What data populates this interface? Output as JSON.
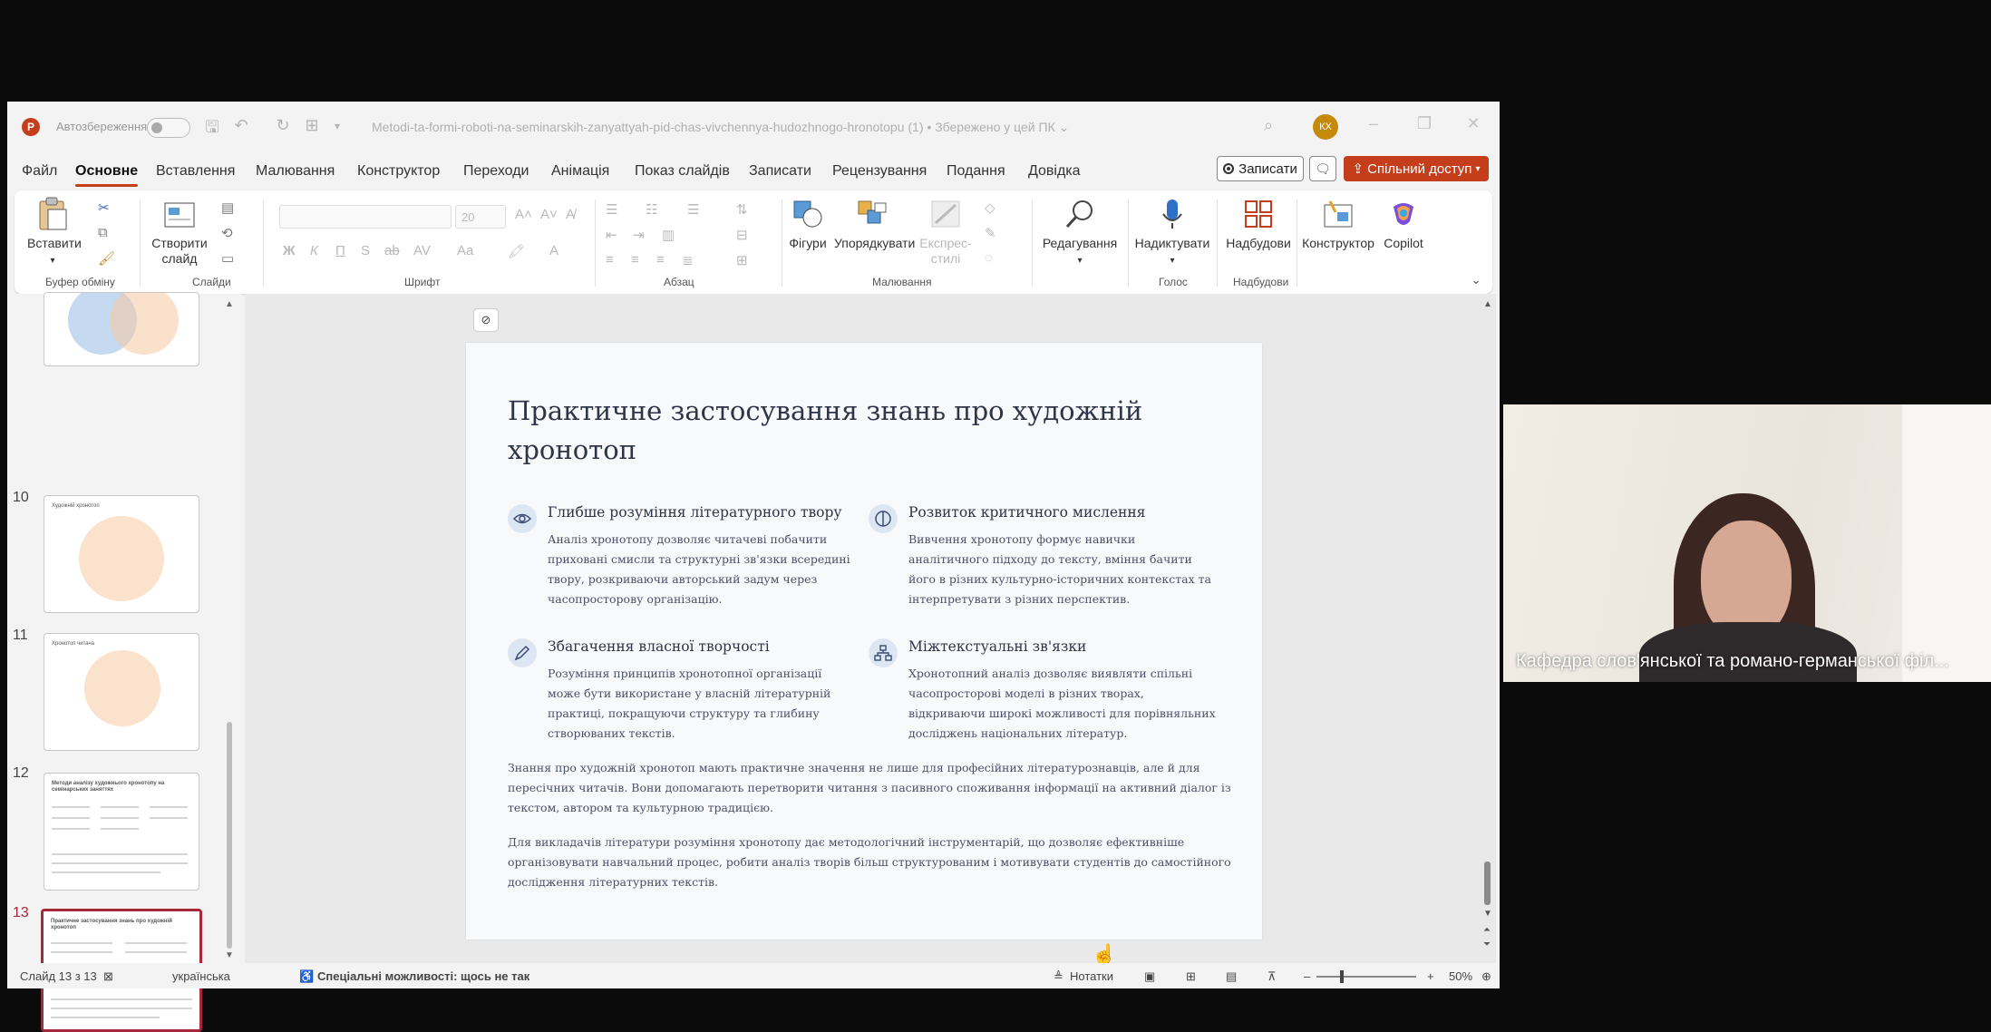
{
  "titlebar": {
    "autosave_label": "Автозбереження",
    "doc_title": "Metodi-ta-formi-roboti-na-seminarskih-zanyattyah-pid-chas-vivchennya-hudozhnogo-hronotopu (1) • Збережено у цей ПК ⌄",
    "avatar_initials": "КХ"
  },
  "tabs": [
    "Файл",
    "Основне",
    "Вставлення",
    "Малювання",
    "Конструктор",
    "Переходи",
    "Анімація",
    "Показ слайдів",
    "Записати",
    "Рецензування",
    "Подання",
    "Довідка"
  ],
  "actions": {
    "record_label": "Записати",
    "share_label": "Спільний доступ"
  },
  "ribbon": {
    "paste_label": "Вставити",
    "new_slide_label": "Створити слайд",
    "font_size": "20",
    "shapes_label": "Фігури",
    "arrange_label": "Упорядкувати",
    "quick_styles_label": "Експрес-стилі",
    "editing_label": "Редагування",
    "dictate_label": "Надиктувати",
    "addins_label": "Надбудови",
    "designer_label": "Конструктор",
    "copilot_label": "Copilot",
    "groups": {
      "clipboard": "Буфер обміну",
      "slides": "Слайди",
      "font": "Шрифт",
      "paragraph": "Абзац",
      "drawing": "Малювання",
      "voice": "Голос",
      "addins": "Надбудови"
    }
  },
  "thumbnails": {
    "numbers": [
      "10",
      "11",
      "12",
      "13"
    ],
    "slide10_title": "Художній хронотоп",
    "slide11_title": "Хронотоп читача",
    "slide12_title": "Методи аналізу художнього хронотопу на семінарських заняттях",
    "slide13_title": "Практичне застосування знань про художній хронотоп"
  },
  "slide": {
    "title": "Практичне застосування знань про художній хронотоп",
    "cards": [
      {
        "icon": "eye-icon",
        "heading": "Глибше розуміння літературного твору",
        "body": "Аналіз хронотопу дозволяє читачеві побачити приховані смисли та структурні зв'язки всередині твору, розкриваючи авторський задум через часопросторову організацію."
      },
      {
        "icon": "brain-icon",
        "heading": "Розвиток критичного мислення",
        "body": "Вивчення хронотопу формує навички аналітичного підходу до тексту, вміння бачити його в різних культурно-історичних контекстах та інтерпретувати з різних перспектив."
      },
      {
        "icon": "pencil-icon",
        "heading": "Збагачення власної творчості",
        "body": "Розуміння принципів хронотопної організації може бути використане у власній літературній практиці, покращуючи структуру та глибину створюваних текстів."
      },
      {
        "icon": "network-icon",
        "heading": "Міжтекстуальні зв'язки",
        "body": "Хронотопний аналіз дозволяє виявляти спільні часопросторові моделі в різних творах, відкриваючи широкі можливості для порівняльних досліджень національних літератур."
      }
    ],
    "paragraph1": "Знання про художній хронотоп мають практичне значення не лише для професійних літературознавців, але й для пересічних читачів. Вони допомагають перетворити читання з пасивного споживання інформації на активний діалог із текстом, автором та культурною традицією.",
    "paragraph2": "Для викладачів літератури розуміння хронотопу дає методологічний інструментарій, що дозволяє ефективніше організовувати навчальний процес, робити аналіз творів більш структурованим і мотивувати студентів до самостійного дослідження літературних текстів."
  },
  "statusbar": {
    "slide_counter": "Слайд 13 з 13",
    "language": "українська",
    "accessibility": "Спеціальні можливості: щось не так",
    "notes": "Нотатки",
    "zoom": "50%"
  },
  "webcam": {
    "caption": "Кафедра слов'янської та романо-германської філ..."
  },
  "colors": {
    "accent": "#c43e1c",
    "active_thumb": "#a5283b",
    "slide_title": "#2e3548"
  }
}
